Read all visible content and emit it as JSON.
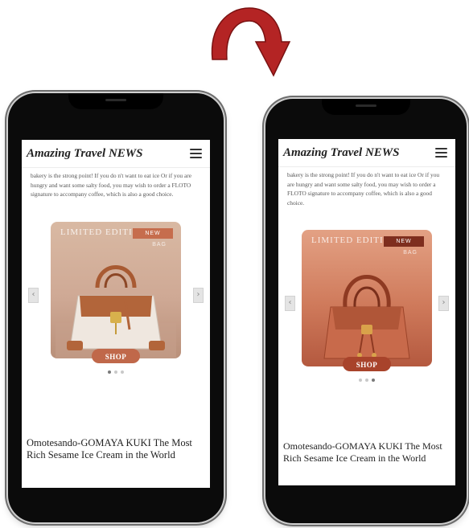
{
  "arrow": {
    "icon": "curved-arrow-icon",
    "color": "#b42424"
  },
  "screens": [
    {
      "site_title": "Amazing Travel NEWS",
      "menu_icon": "hamburger-menu-icon",
      "intro": "bakery is the strong point! If you do n't want to eat ice Or if you are hungry and want some salty food, you may wish to order a FLOTO signature to accompany coffee, which is also a good choice.",
      "promo": {
        "limited_label": "LIMITED EDITION",
        "new_badge": "NEW",
        "badge_sub": "BAG",
        "product": "white-leather-handbag",
        "prev_icon": "chevron-left-icon",
        "next_icon": "chevron-right-icon",
        "shop_label": "SHOP",
        "prev_symbol": "‹",
        "next_symbol": "›",
        "active_dot": 1
      },
      "headline": "Omotesando-GOMAYA KUKI The Most Rich Sesame Ice Cream in the World"
    },
    {
      "site_title": "Amazing Travel NEWS",
      "menu_icon": "hamburger-menu-icon",
      "intro": "bakery is the strong point! If you do n't want to eat ice Or if you are hungry and want some salty food, you may wish to order a FLOTO signature to accompany coffee, which is also a good choice.",
      "promo": {
        "limited_label": "LIMITED EDITION",
        "new_badge": "NEW",
        "badge_sub": "BAG",
        "product": "tan-leather-handbag",
        "prev_icon": "chevron-left-icon",
        "next_icon": "chevron-right-icon",
        "shop_label": "SHOP",
        "prev_symbol": "‹",
        "next_symbol": "›",
        "active_dot": 3
      },
      "headline": "Omotesando-GOMAYA KUKI The Most Rich Sesame Ice Cream in the World"
    }
  ]
}
